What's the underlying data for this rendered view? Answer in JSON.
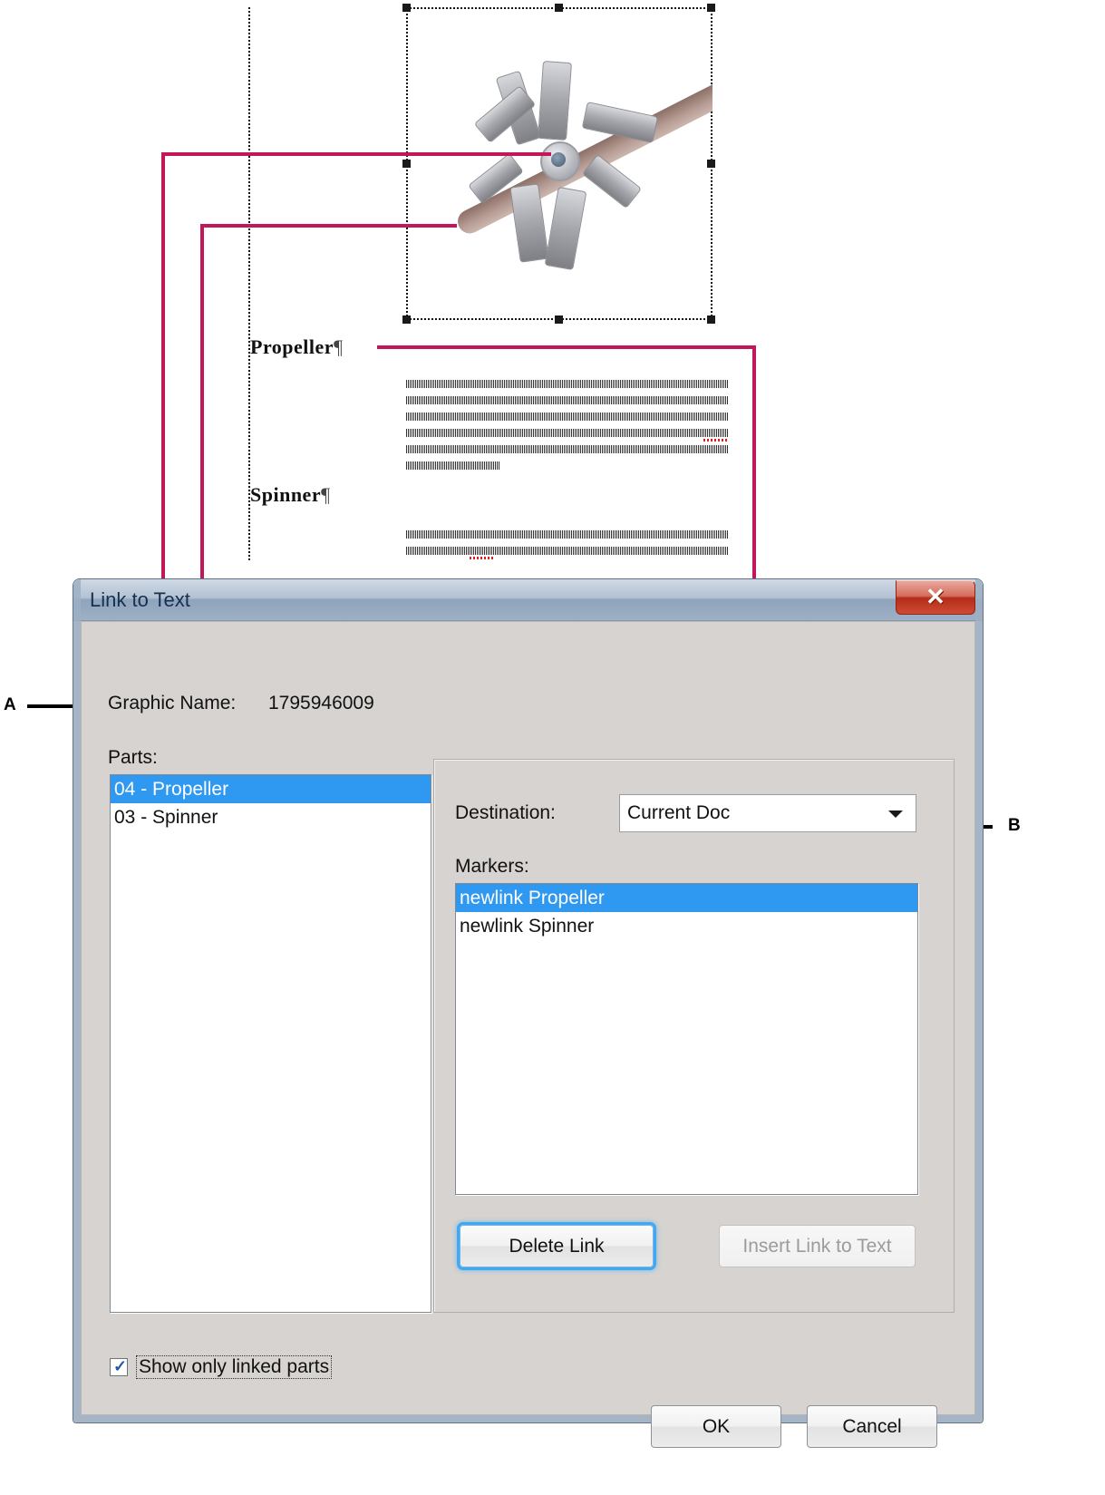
{
  "document": {
    "headings": [
      {
        "text": "Propeller",
        "pilcrow": "¶"
      },
      {
        "text": "Spinner",
        "pilcrow": "¶"
      }
    ],
    "graphic_alt": "propeller-and-radial-engine-image"
  },
  "callouts": [
    {
      "letter": "A",
      "target": "parts-list"
    },
    {
      "letter": "B",
      "target": "markers-list"
    }
  ],
  "dialog": {
    "title": "Link to Text",
    "close_label": "✕",
    "graphic_name_label": "Graphic Name:",
    "graphic_name_value": "1795946009",
    "parts_label": "Parts:",
    "parts": [
      {
        "label": "04 - Propeller",
        "selected": true
      },
      {
        "label": "03 - Spinner",
        "selected": false
      }
    ],
    "destination_label": "Destination:",
    "destination_value": "Current Doc",
    "destination_options": [
      "Current Doc"
    ],
    "markers_label": "Markers:",
    "markers": [
      {
        "label": "newlink Propeller",
        "selected": true
      },
      {
        "label": "newlink Spinner",
        "selected": false
      }
    ],
    "delete_link_label": "Delete Link",
    "insert_link_label": "Insert Link to Text",
    "show_only_linked_label": "Show only linked parts",
    "show_only_linked_checked": true,
    "ok_label": "OK",
    "cancel_label": "Cancel"
  },
  "colors": {
    "callout": "#c2185b",
    "selection": "#2f98f0",
    "dialog_face": "#d6d3d0",
    "close_button": "#b42c18",
    "focus_glow": "#3fa9f5"
  }
}
